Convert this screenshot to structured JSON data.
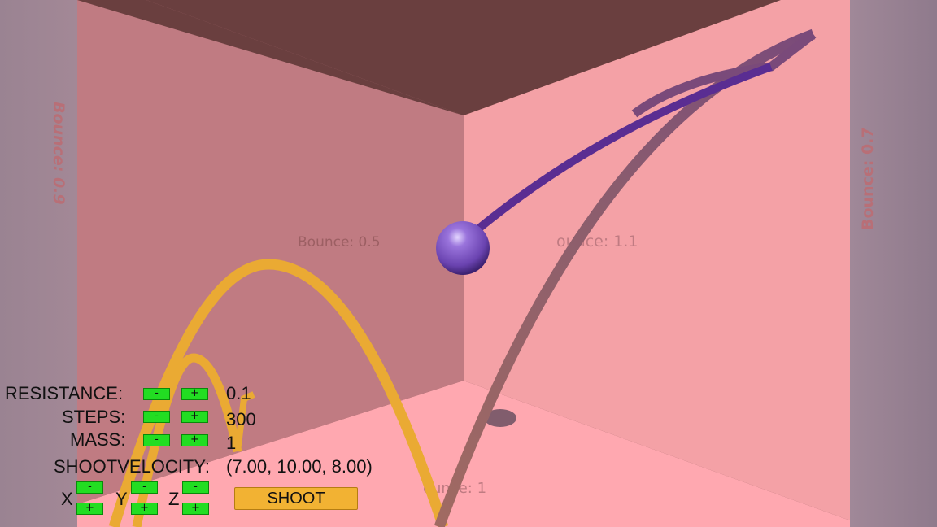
{
  "walls": {
    "left_label": "Bounce: 0.9",
    "right_label": "Bounce: 0.7",
    "back_left_label": "Bounce: 0.5",
    "back_right_label": "ounce: 1.1",
    "floor_label": "ounce: 1"
  },
  "controls": {
    "resistance": {
      "label": "RESISTANCE:",
      "value": "0.1",
      "minus": "-",
      "plus": "+"
    },
    "steps": {
      "label": "STEPS:",
      "value": "300",
      "minus": "-",
      "plus": "+"
    },
    "mass": {
      "label": "MASS:",
      "value": "1",
      "minus": "-",
      "plus": "+"
    },
    "shoot_velocity": {
      "label": "SHOOTVELOCITY:",
      "value": "(7.00, 10.00, 8.00)"
    },
    "axes": [
      {
        "name": "X",
        "minus": "-",
        "plus": "+"
      },
      {
        "name": "Y",
        "minus": "-",
        "plus": "+"
      },
      {
        "name": "Z",
        "minus": "-",
        "plus": "+"
      }
    ],
    "shoot_label": "SHOOT"
  },
  "colors": {
    "ball": "#7d55c4",
    "purple_trail": "#5a2d92",
    "orange_trail": "#eaaa33",
    "mauve_trail": "#8f5a6a",
    "button_green": "#22dd22",
    "shoot_button": "#f2b233"
  }
}
